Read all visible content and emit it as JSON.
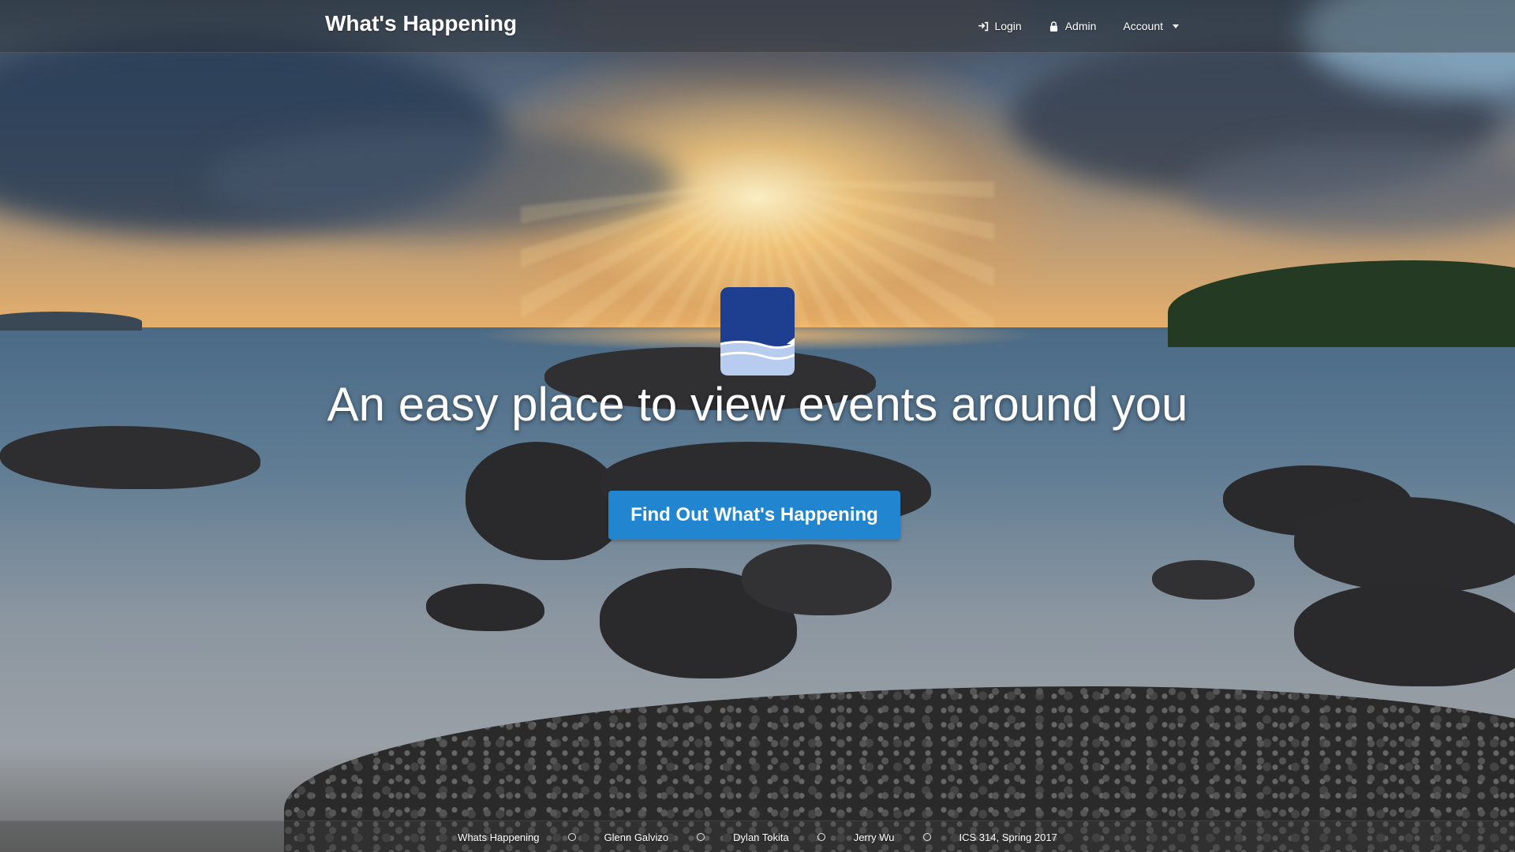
{
  "navbar": {
    "brand": "What's Happening",
    "items": [
      {
        "label": "Login",
        "icon": "sign-in-icon"
      },
      {
        "label": "Admin",
        "icon": "lock-icon"
      },
      {
        "label": "Account",
        "icon": "dropdown-caret-icon"
      }
    ]
  },
  "hero": {
    "logo_icon": "book-logo-icon",
    "headline": "An easy place to view events around you",
    "cta_label": "Find Out What's Happening"
  },
  "footer": {
    "items": [
      "Whats Happening",
      "Glenn Galvizo",
      "Dylan Tokita",
      "Jerry Wu",
      "ICS 314, Spring 2017"
    ],
    "separator_icon": "circle-icon"
  },
  "colors": {
    "accent": "#2185d0",
    "logo_dark": "#1e3f8f",
    "logo_light": "#b8ccf0",
    "text": "#ffffff"
  }
}
